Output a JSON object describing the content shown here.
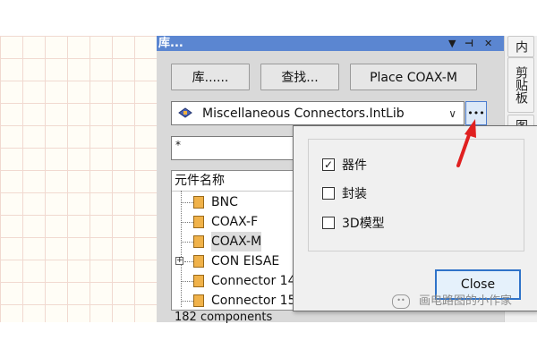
{
  "panel": {
    "title": "库...",
    "titlebar_icons": {
      "menu": "▼",
      "pin": "⊣",
      "close": "✕"
    },
    "buttons": {
      "library": "库......",
      "search": "查找...",
      "place": "Place COAX-M"
    },
    "library_selector": {
      "icon": "library-icon",
      "value": "Miscellaneous Connectors.IntLib"
    },
    "filter": {
      "value": "*"
    },
    "list": {
      "header": "元件名称",
      "items": [
        "BNC",
        "COAX-F",
        "COAX-M",
        "CON EISAE",
        "Connector 14",
        "Connector 15"
      ],
      "selected_index": 2
    },
    "status": "182 components"
  },
  "right_tabs": [
    "内",
    "剪贴板",
    "图"
  ],
  "popup": {
    "options": [
      {
        "label": "器件",
        "checked": true
      },
      {
        "label": "封装",
        "checked": false
      },
      {
        "label": "3D模型",
        "checked": false
      }
    ],
    "checked_mark": "☑",
    "close_label": "Close"
  },
  "watermark": {
    "text": "画电路图的小作家"
  },
  "colors": {
    "titlebar": "#5b86d1",
    "annotation_arrow": "#e02020",
    "close_border": "#2f73c9"
  }
}
